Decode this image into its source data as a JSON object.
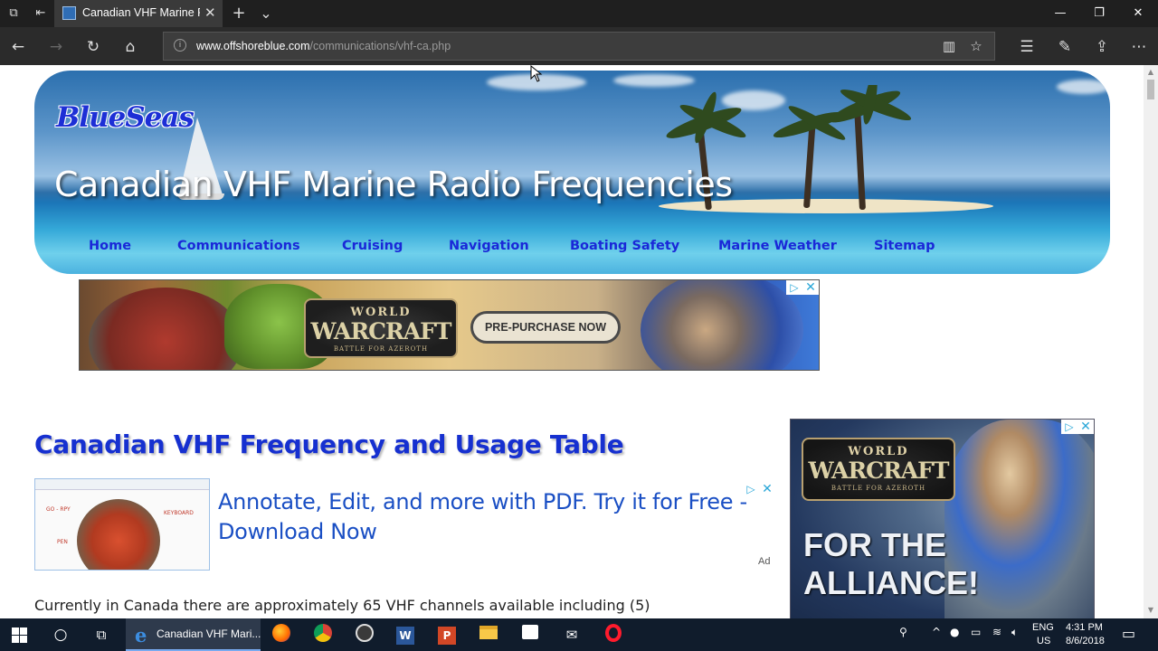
{
  "browser": {
    "tab_title": "Canadian VHF Marine F",
    "url_domain": "www.offshoreblue.com",
    "url_path": "/communications/vhf-ca.php",
    "tab_close": "✕",
    "new_tab": "+",
    "tab_list": "⌄"
  },
  "site": {
    "logo_text": "BlueSeas",
    "banner_title": "Canadian VHF Marine Radio Frequencies",
    "nav": [
      {
        "label": "Home"
      },
      {
        "label": "Communications"
      },
      {
        "label": "Cruising"
      },
      {
        "label": "Navigation"
      },
      {
        "label": "Boating Safety"
      },
      {
        "label": "Marine Weather"
      },
      {
        "label": "Sitemap"
      }
    ]
  },
  "ads": {
    "wow_banner": {
      "logo_top": "WORLD",
      "logo_main": "WARCRAFT",
      "logo_sub": "BATTLE FOR AZEROTH",
      "button": "PRE-PURCHASE NOW"
    },
    "pdf_ad": {
      "headline": "Annotate, Edit, and more with PDF. Try it for Free - Download Now",
      "label": "Ad",
      "doodle_1": "GO - RPY",
      "doodle_2": "KEYBOARD",
      "doodle_3": "PEN"
    },
    "side_ad": {
      "logo_top": "WORLD",
      "logo_main": "WARCRAFT",
      "logo_sub": "BATTLE FOR AZEROTH",
      "line1": "FOR THE",
      "line2": "ALLIANCE!"
    }
  },
  "content": {
    "heading": "Canadian VHF Frequency and Usage Table",
    "intro": "Currently in Canada there are approximately 65 VHF channels available including (5)"
  },
  "taskbar": {
    "active_app_label": "Canadian VHF Mari...",
    "lang_top": "ENG",
    "lang_bottom": "US",
    "time": "4:31 PM",
    "date": "8/6/2018"
  },
  "colors": {
    "link_blue": "#1a28d8",
    "heading_blue": "#1630d0",
    "ad_link_blue": "#1a4fc4",
    "taskbar_bg": "#101c2c",
    "titlebar_bg": "#1f1f1f"
  },
  "icons": {
    "titlebar": [
      "tab-set-aside-icon",
      "tab-preview-icon",
      "minimize-icon",
      "maximize-icon",
      "close-icon"
    ],
    "navbar": [
      "back-icon",
      "forward-icon",
      "refresh-icon",
      "home-icon",
      "reading-view-icon",
      "favorite-star-icon",
      "favorites-hub-icon",
      "web-note-icon",
      "share-icon",
      "more-icon"
    ],
    "taskbar": [
      "windows-start-icon",
      "cortana-search-icon",
      "task-view-icon",
      "edge-icon",
      "firefox-icon",
      "chrome-icon",
      "obs-icon",
      "word-icon",
      "powerpoint-icon",
      "file-explorer-icon",
      "store-icon",
      "mail-icon",
      "opera-icon"
    ]
  }
}
